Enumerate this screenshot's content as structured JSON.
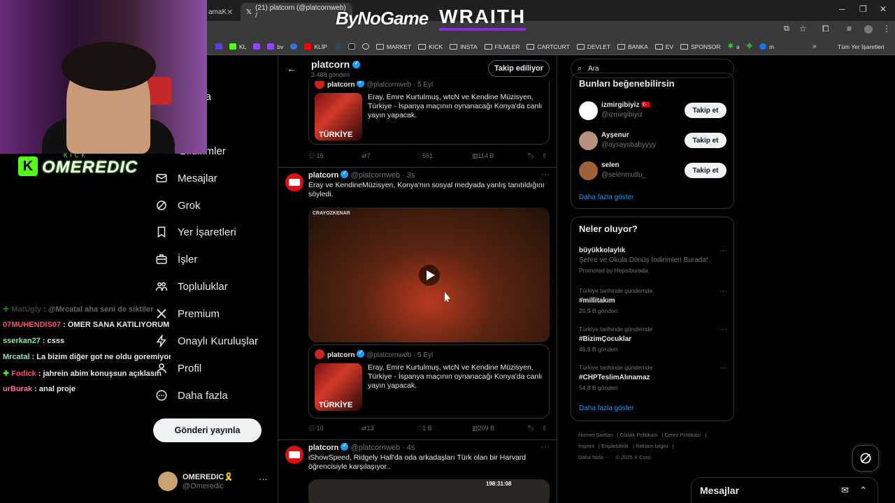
{
  "browser": {
    "tabs": [
      {
        "label": "amaK",
        "active": false
      },
      {
        "label": "(21) platcorn (@platcornweb) /",
        "active": true
      }
    ],
    "bookmarks": [
      {
        "label": "KL",
        "color": "#53fc18"
      },
      {
        "label": "bv",
        "color": "#9146ff"
      },
      {
        "label": "KLİP",
        "color": "#ff0000"
      },
      {
        "label": "MARKET",
        "folder": true
      },
      {
        "label": "KICK",
        "folder": true
      },
      {
        "label": "INSTA",
        "folder": true
      },
      {
        "label": "FİLMLER",
        "folder": true
      },
      {
        "label": "CARTCURT",
        "folder": true
      },
      {
        "label": "DEVLET",
        "folder": true
      },
      {
        "label": "BANKA",
        "folder": true
      },
      {
        "label": "EV",
        "folder": true
      },
      {
        "label": "SPONSOR",
        "folder": true
      },
      {
        "label": "a",
        "color": "#2ecc40"
      },
      {
        "label": "m",
        "color": "#1a73e8"
      }
    ],
    "all_bookmarks": "Tüm Yer İşaretleri"
  },
  "overlay": {
    "brand_left": "ByNoGame",
    "brand_right": "WRAITH",
    "kick_small": "KICK",
    "kick_name": "OMEREDIC",
    "chat": [
      {
        "user": "MatUgly",
        "text": ": @Mrcatal aha seni de siktiler",
        "color": "#888",
        "faded": true
      },
      {
        "user": "07MUHENDIS07",
        "text": ": ÖMER SANA KATILIYORUM",
        "color": "#ff4b6e"
      },
      {
        "user": "sserkan27",
        "text": ": csss",
        "color": "#8ee4af"
      },
      {
        "user": "Mrcatal",
        "text": ": La bizim diğer got ne oldu goremiyorum",
        "color": "#8ee4af"
      },
      {
        "user": "Fodick",
        "text": ": jahrein abim konuşsun açıklasın",
        "color": "#ff4b6e"
      },
      {
        "user": "urBurak",
        "text": ": anal proje",
        "color": "#ff6fa8"
      }
    ]
  },
  "nav": {
    "items": [
      {
        "label": "yfa",
        "icon": "home-icon"
      },
      {
        "label": "Bildirimler",
        "icon": "bell-icon"
      },
      {
        "label": "Mesajlar",
        "icon": "mail-icon"
      },
      {
        "label": "Grok",
        "icon": "grok-icon"
      },
      {
        "label": "Yer İşaretleri",
        "icon": "bookmark-icon"
      },
      {
        "label": "İşler",
        "icon": "briefcase-icon"
      },
      {
        "label": "Topluluklar",
        "icon": "communities-icon"
      },
      {
        "label": "Premium",
        "icon": "x-logo-icon"
      },
      {
        "label": "Onaylı Kuruluşlar",
        "icon": "lightning-icon"
      },
      {
        "label": "Profil",
        "icon": "person-icon"
      },
      {
        "label": "Daha fazla",
        "icon": "more-circle-icon"
      }
    ],
    "post_button": "Gönderi yayınla",
    "account": {
      "name": "OMEREDIC🎗️",
      "handle": "@Omeredic"
    }
  },
  "feed": {
    "profile_name": "platcorn",
    "post_count": "3.488 gönderi",
    "follow_label": "Takip ediliyor",
    "quote_top": {
      "name": "platcorn",
      "handle": "@platcornweb",
      "time": "· 5 Eyl",
      "text": "Eray, Emre Kurtulmuş, wtcN ve Kendine Müzisyen, Türkiye - İspanya maçının oynanacağı Konya'da canlı yayın yapacak.",
      "thumb_text": "TÜRKİYE"
    },
    "actions_top": {
      "replies": "16",
      "reposts": "7",
      "likes": "661",
      "views": "114 B"
    },
    "tweet1": {
      "name": "platcorn",
      "handle": "@platcornweb",
      "time": "· 3s",
      "text": "Eray ve KendineMüzisyen, Konya'nın sosyal medyada yanlış tanıtıldığını söyledi.",
      "video_tag": "CRAYOZKENAR"
    },
    "quote_mid": {
      "name": "platcorn",
      "handle": "@platcornweb",
      "time": "· 5 Eyl",
      "text": "Eray, Emre Kurtulmuş, wtcN ve Kendine Müzisyen, Türkiye - İspanya maçının oynanacağı Konya'da canlı yayın yapacak.",
      "thumb_text": "TÜRKİYE"
    },
    "actions_mid": {
      "replies": "10",
      "reposts": "13",
      "likes": "1 B",
      "views": "209 B"
    },
    "tweet2": {
      "name": "platcorn",
      "handle": "@platcornweb",
      "time": "· 4s",
      "text": "iShowSpeed, Ridgely Hall'da oda arkadaşları Türk olan bir Harvard öğrencisiyle karşılaşıyor..",
      "video_time": "198:31:08"
    }
  },
  "sidebar_right": {
    "search_placeholder": "Ara",
    "who_title": "Bunları beğenebilirsin",
    "who": [
      {
        "name": "izmirgibiyiz 🇹🇷",
        "handle": "@izmirgibiyiz",
        "button": "Takip et"
      },
      {
        "name": "Ayşenur",
        "handle": "@aysaysbabyyyy",
        "button": "Takip et"
      },
      {
        "name": "selen",
        "handle": "@selenmutlu_",
        "button": "Takip et"
      }
    ],
    "who_more": "Daha fazla göster",
    "trends_title": "Neler oluyor?",
    "promo": {
      "title": "büyükkolaylık",
      "desc": "Şehre ve Okula Dönüş İndirimleri Burada!",
      "by": "Promoted by Hepsiburada"
    },
    "trends": [
      {
        "cat": "Türkiye tarihinde gündemde",
        "title": "#millitakım",
        "count": "25,9 B gönderi"
      },
      {
        "cat": "Türkiye tarihinde gündemde",
        "title": "#BizimÇocuklar",
        "count": "46,8 B gönderi"
      },
      {
        "cat": "Türkiye tarihinde gündemde",
        "title": "#CHPTeslimAlınamaz",
        "count": "54,8 B gönderi"
      }
    ],
    "trends_more": "Daha fazla göster",
    "footer": [
      "Hizmet Şartları",
      "Gizlilik Politikası",
      "Çerez Politikası",
      "İmprint",
      "Erişilebilirlik",
      "Reklam bilgisi",
      "Daha fazla ···",
      "© 2025 X Corp."
    ]
  },
  "messages_drawer": {
    "title": "Mesajlar"
  }
}
